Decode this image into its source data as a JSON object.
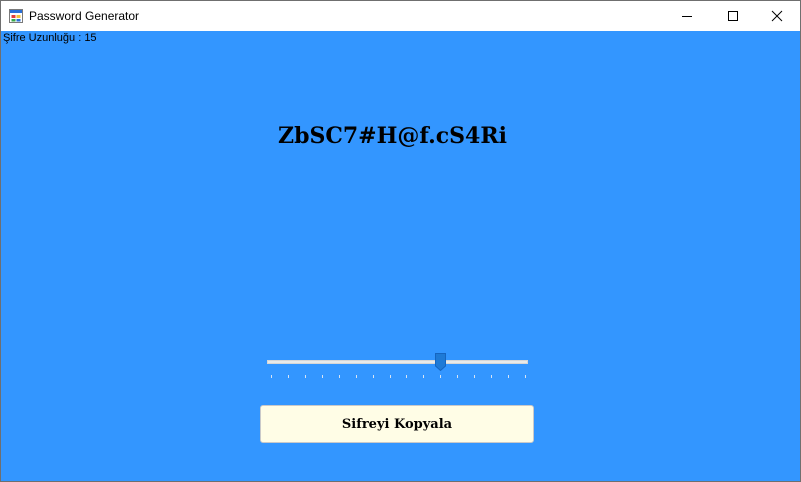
{
  "window": {
    "title": "Password Generator",
    "app_icon": "windows-form-icon",
    "controls": [
      "minimize-icon",
      "maximize-icon",
      "close-icon"
    ]
  },
  "length_label": "Şifre Uzunluğu : 15",
  "password": "ZbSC7#H@f.cS4Ri",
  "slider": {
    "min": 0,
    "max": 15,
    "value": 10,
    "tick_count": 16
  },
  "copy_button": {
    "label": "Sifreyi Kopyala"
  },
  "colors": {
    "background": "#3396ff",
    "button_bg": "#fffde6",
    "thumb": "#1e7ad6",
    "title_bar": "#ffffff"
  }
}
